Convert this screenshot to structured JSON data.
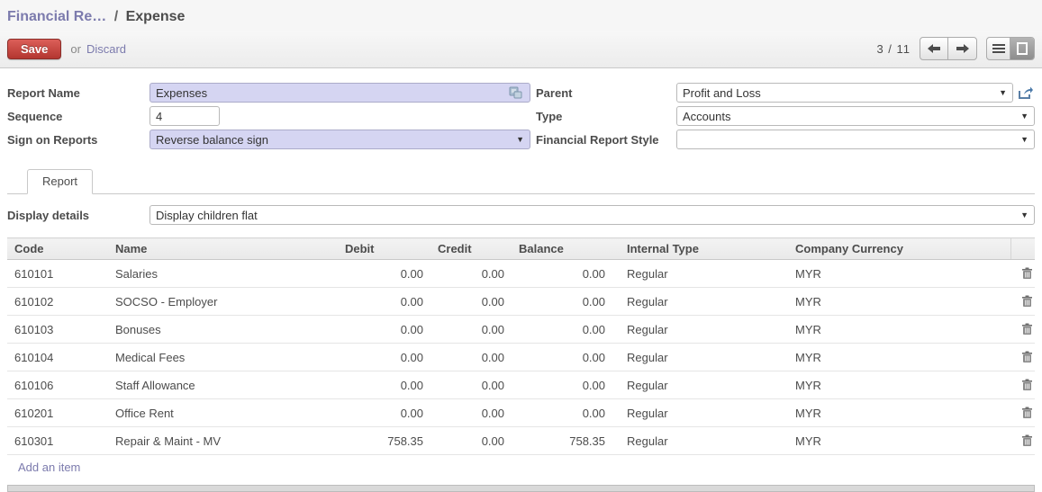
{
  "breadcrumb": {
    "parent": "Financial Re…",
    "separator": "/",
    "current": "Expense"
  },
  "toolbar": {
    "save_label": "Save",
    "or_label": "or",
    "discard_label": "Discard",
    "pager": {
      "text": "3 / 11"
    }
  },
  "icons": {
    "translate": "translate-page-icon",
    "open_record": "external-link-icon",
    "prev": "left-arrow-icon",
    "next": "right-arrow-icon",
    "list_view": "list-lines-icon",
    "form_view": "form-rectangle-icon",
    "delete": "trash-icon",
    "dropdown": "caret-down"
  },
  "colors": {
    "accent_red": "#b33630",
    "link_purple": "#7c7bad",
    "required_field_bg": "#d5d5f2",
    "text_dark": "#4c4c4c"
  },
  "form": {
    "report_name": {
      "label": "Report Name",
      "value": "Expenses"
    },
    "sequence": {
      "label": "Sequence",
      "value": "4"
    },
    "sign_on_reports": {
      "label": "Sign on Reports",
      "value": "Reverse balance sign"
    },
    "parent": {
      "label": "Parent",
      "value": "Profit and Loss"
    },
    "type": {
      "label": "Type",
      "value": "Accounts"
    },
    "financial_report_style": {
      "label": "Financial Report Style",
      "value": ""
    },
    "tab": "Report",
    "display_details": {
      "label": "Display details",
      "value": "Display children flat"
    }
  },
  "table": {
    "headers": [
      "Code",
      "Name",
      "Debit",
      "Credit",
      "Balance",
      "Internal Type",
      "Company Currency"
    ],
    "rows": [
      {
        "code": "610101",
        "name": "Salaries",
        "debit": "0.00",
        "credit": "0.00",
        "balance": "0.00",
        "internal_type": "Regular",
        "currency": "MYR"
      },
      {
        "code": "610102",
        "name": "SOCSO - Employer",
        "debit": "0.00",
        "credit": "0.00",
        "balance": "0.00",
        "internal_type": "Regular",
        "currency": "MYR"
      },
      {
        "code": "610103",
        "name": "Bonuses",
        "debit": "0.00",
        "credit": "0.00",
        "balance": "0.00",
        "internal_type": "Regular",
        "currency": "MYR"
      },
      {
        "code": "610104",
        "name": "Medical Fees",
        "debit": "0.00",
        "credit": "0.00",
        "balance": "0.00",
        "internal_type": "Regular",
        "currency": "MYR"
      },
      {
        "code": "610106",
        "name": "Staff Allowance",
        "debit": "0.00",
        "credit": "0.00",
        "balance": "0.00",
        "internal_type": "Regular",
        "currency": "MYR"
      },
      {
        "code": "610201",
        "name": "Office Rent",
        "debit": "0.00",
        "credit": "0.00",
        "balance": "0.00",
        "internal_type": "Regular",
        "currency": "MYR"
      },
      {
        "code": "610301",
        "name": "Repair & Maint - MV",
        "debit": "758.35",
        "credit": "0.00",
        "balance": "758.35",
        "internal_type": "Regular",
        "currency": "MYR"
      }
    ],
    "add_item_label": "Add an item"
  }
}
